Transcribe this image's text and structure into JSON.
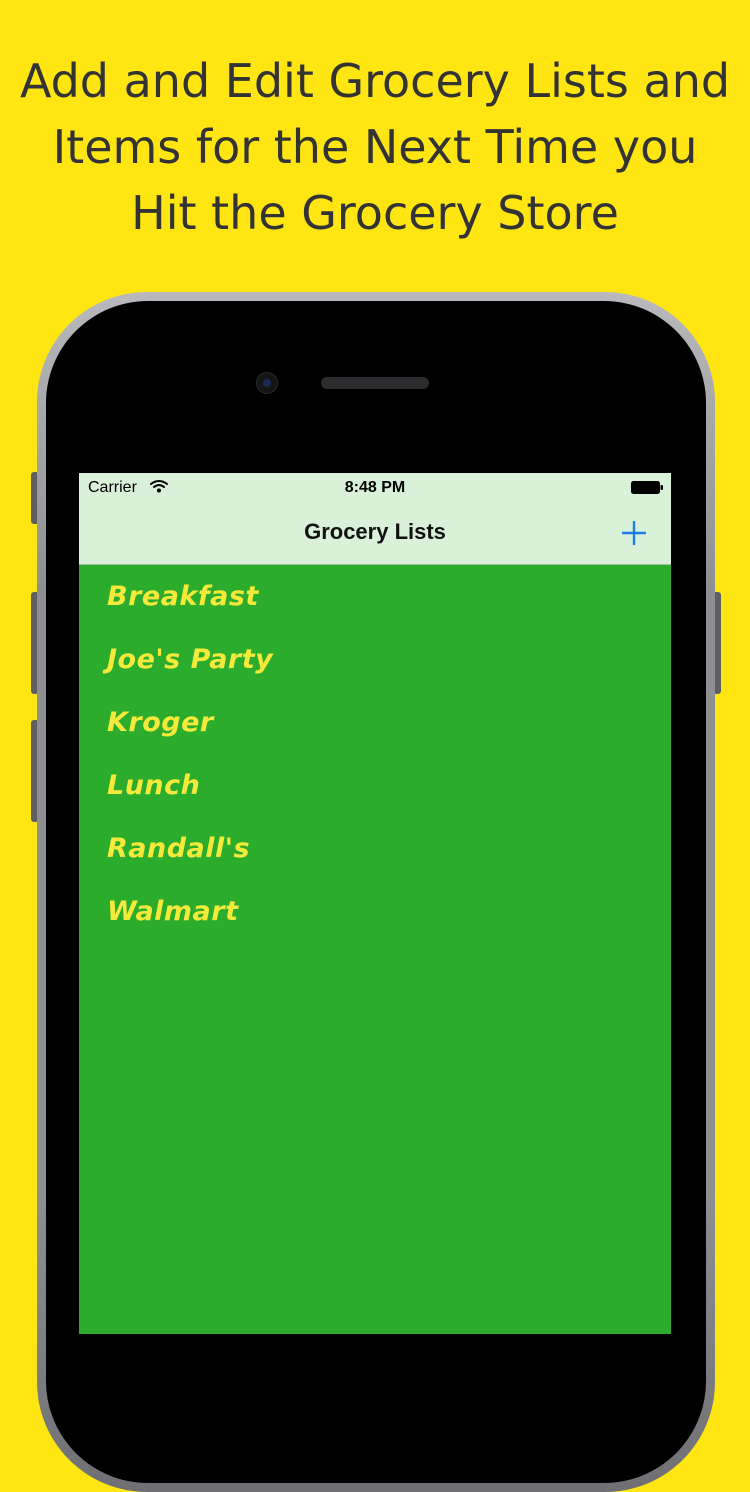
{
  "headline": {
    "line1": "Add and Edit Grocery Lists and",
    "line2": "Items for the Next Time you",
    "line3": "Hit the Grocery Store"
  },
  "status_bar": {
    "carrier": "Carrier",
    "time": "8:48 PM",
    "wifi_icon": "wifi-icon",
    "battery_icon": "battery-icon"
  },
  "nav": {
    "title": "Grocery Lists",
    "add_icon": "plus-icon"
  },
  "lists": [
    "Breakfast",
    "Joe's Party",
    "Kroger",
    "Lunch",
    "Randall's",
    "Walmart"
  ],
  "colors": {
    "background": "#FFE512",
    "screen_bg": "#2CAC2C",
    "bar_bg": "#D9F0D9",
    "list_text": "#F5EA3A",
    "accent": "#1E7BF0"
  }
}
